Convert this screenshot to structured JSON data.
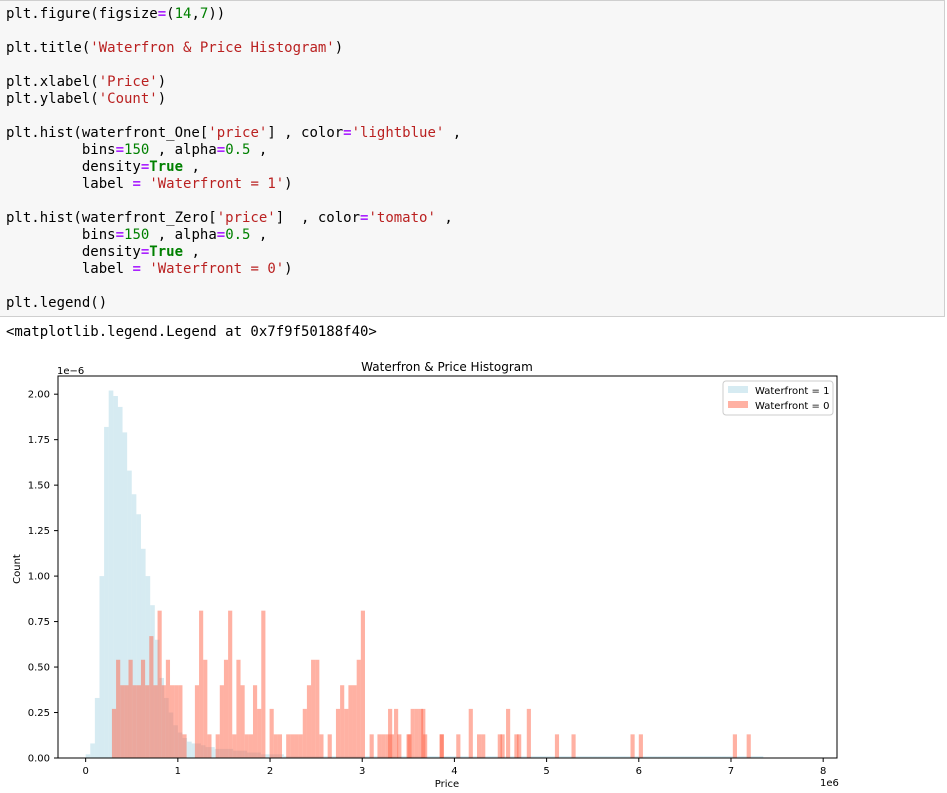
{
  "code_lines": [
    {
      "i": 0,
      "tokens": [
        {
          "t": "plt.figure(figsize",
          "c": ""
        },
        {
          "t": "=",
          "c": "op"
        },
        {
          "t": "(",
          "c": ""
        },
        {
          "t": "14",
          "c": "num"
        },
        {
          "t": ",",
          "c": ""
        },
        {
          "t": "7",
          "c": "num"
        },
        {
          "t": "))",
          "c": ""
        }
      ]
    },
    {
      "i": 2,
      "tokens": [
        {
          "t": "plt.title(",
          "c": ""
        },
        {
          "t": "'Waterfron & Price Histogram'",
          "c": "str"
        },
        {
          "t": ")",
          "c": ""
        }
      ]
    },
    {
      "i": 4,
      "tokens": [
        {
          "t": "plt.xlabel(",
          "c": ""
        },
        {
          "t": "'Price'",
          "c": "str"
        },
        {
          "t": ")",
          "c": ""
        }
      ]
    },
    {
      "i": 5,
      "tokens": [
        {
          "t": "plt.ylabel(",
          "c": ""
        },
        {
          "t": "'Count'",
          "c": "str"
        },
        {
          "t": ")",
          "c": ""
        }
      ]
    },
    {
      "i": 7,
      "tokens": [
        {
          "t": "plt.hist(waterfront_One[",
          "c": ""
        },
        {
          "t": "'price'",
          "c": "str"
        },
        {
          "t": "] , color",
          "c": ""
        },
        {
          "t": "=",
          "c": "op"
        },
        {
          "t": "'lightblue'",
          "c": "str"
        },
        {
          "t": " ,",
          "c": ""
        }
      ]
    },
    {
      "i": 8,
      "tokens": [
        {
          "t": "         bins",
          "c": ""
        },
        {
          "t": "=",
          "c": "op"
        },
        {
          "t": "150",
          "c": "num"
        },
        {
          "t": " , alpha",
          "c": ""
        },
        {
          "t": "=",
          "c": "op"
        },
        {
          "t": "0.5",
          "c": "num"
        },
        {
          "t": " ,",
          "c": ""
        }
      ]
    },
    {
      "i": 9,
      "tokens": [
        {
          "t": "         density",
          "c": ""
        },
        {
          "t": "=",
          "c": "op"
        },
        {
          "t": "True",
          "c": "kw"
        },
        {
          "t": " ,",
          "c": ""
        }
      ]
    },
    {
      "i": 10,
      "tokens": [
        {
          "t": "         label ",
          "c": ""
        },
        {
          "t": "=",
          "c": "op"
        },
        {
          "t": " ",
          "c": ""
        },
        {
          "t": "'Waterfront = 1'",
          "c": "str"
        },
        {
          "t": ")",
          "c": ""
        }
      ]
    },
    {
      "i": 12,
      "tokens": [
        {
          "t": "plt.hist(waterfront_Zero[",
          "c": ""
        },
        {
          "t": "'price'",
          "c": "str"
        },
        {
          "t": "]  , color",
          "c": ""
        },
        {
          "t": "=",
          "c": "op"
        },
        {
          "t": "'tomato'",
          "c": "str"
        },
        {
          "t": " ,",
          "c": ""
        }
      ]
    },
    {
      "i": 13,
      "tokens": [
        {
          "t": "         bins",
          "c": ""
        },
        {
          "t": "=",
          "c": "op"
        },
        {
          "t": "150",
          "c": "num"
        },
        {
          "t": " , alpha",
          "c": ""
        },
        {
          "t": "=",
          "c": "op"
        },
        {
          "t": "0.5",
          "c": "num"
        },
        {
          "t": " ,",
          "c": ""
        }
      ]
    },
    {
      "i": 14,
      "tokens": [
        {
          "t": "         density",
          "c": ""
        },
        {
          "t": "=",
          "c": "op"
        },
        {
          "t": "True",
          "c": "kw"
        },
        {
          "t": " ,",
          "c": ""
        }
      ]
    },
    {
      "i": 15,
      "tokens": [
        {
          "t": "         label ",
          "c": ""
        },
        {
          "t": "=",
          "c": "op"
        },
        {
          "t": " ",
          "c": ""
        },
        {
          "t": "'Waterfront = 0'",
          "c": "str"
        },
        {
          "t": ")",
          "c": ""
        }
      ]
    },
    {
      "i": 17,
      "tokens": [
        {
          "t": "plt.legend()",
          "c": ""
        }
      ]
    }
  ],
  "output_text": "<matplotlib.legend.Legend at 0x7f9f50188f40>",
  "chart_data": {
    "type": "bar",
    "title": "Waterfron & Price Histogram",
    "xlabel": "Price",
    "ylabel": "Count",
    "x_offset_label": "1e6",
    "y_offset_label": "1e−6",
    "xlim": [
      -300000,
      8150000
    ],
    "ylim": [
      0,
      2.1
    ],
    "x_ticks": [
      0,
      1,
      2,
      3,
      4,
      5,
      6,
      7,
      8
    ],
    "x_tick_labels": [
      "0",
      "1",
      "2",
      "3",
      "4",
      "5",
      "6",
      "7",
      "8"
    ],
    "y_ticks": [
      0,
      0.25,
      0.5,
      0.75,
      1.0,
      1.25,
      1.5,
      1.75,
      2.0
    ],
    "y_tick_labels": [
      "0.00",
      "0.25",
      "0.50",
      "0.75",
      "1.00",
      "1.25",
      "1.50",
      "1.75",
      "2.00"
    ],
    "legend_position": "top-right",
    "colors": {
      "series0": "#add8e6",
      "series1": "#ff6347"
    },
    "series": [
      {
        "name": "Waterfront = 1",
        "bin_width": 50000,
        "bin_start": 0,
        "values": [
          0.02,
          0.08,
          0.33,
          1.0,
          1.82,
          2.02,
          1.99,
          1.93,
          1.79,
          1.58,
          1.45,
          1.34,
          1.15,
          1.0,
          0.84,
          0.65,
          0.44,
          0.33,
          0.25,
          0.18,
          0.14,
          0.11,
          0.09,
          0.08,
          0.08,
          0.07,
          0.06,
          0.06,
          0.05,
          0.05,
          0.05,
          0.05,
          0.04,
          0.04,
          0.04,
          0.03,
          0.03,
          0.03,
          0.02,
          0.02,
          0.02,
          0.02,
          0.02,
          0.01,
          0.01,
          0.01,
          0.01,
          0.01,
          0.01,
          0.01,
          0.01,
          0.01,
          0.01,
          0.01,
          0.01,
          0.01,
          0.01,
          0.01,
          0.01,
          0.01,
          0.01,
          0.01,
          0.01,
          0.01,
          0.01,
          0.01,
          0.01,
          0.01,
          0.01,
          0.01,
          0.01,
          0.01,
          0.01,
          0.01,
          0.01,
          0.01,
          0.01,
          0.01,
          0.01,
          0.01,
          0.01,
          0.01,
          0.01,
          0.01,
          0.01,
          0.01,
          0.01,
          0.01,
          0.01,
          0.01,
          0.01,
          0.01,
          0.01,
          0.01,
          0.01,
          0.01,
          0.01,
          0.01,
          0.01,
          0.01,
          0.01,
          0.01,
          0.01,
          0.01,
          0.01,
          0.01,
          0.01,
          0.01,
          0.01,
          0.01,
          0.01,
          0.01,
          0.01,
          0.01,
          0.01,
          0.01,
          0.01,
          0.01,
          0.01,
          0.01,
          0.01,
          0.01,
          0.01,
          0.01,
          0.01,
          0.01,
          0.01,
          0.01,
          0.01,
          0.01,
          0.01,
          0.01,
          0.01,
          0.01,
          0.01,
          0.01,
          0.01,
          0.01,
          0.01,
          0.01,
          0.01,
          0.01,
          0.01,
          0.01,
          0.01,
          0.01,
          0.01
        ]
      },
      {
        "name": "Waterfront = 0",
        "bin_width": 45000,
        "bin_start": 285000,
        "values": [
          0.27,
          0.54,
          0.4,
          0.4,
          0.54,
          0.4,
          0.4,
          0.54,
          0.4,
          0.67,
          0.4,
          0.81,
          0.4,
          0.54,
          0.4,
          0.4,
          0.4,
          0.13,
          0.0,
          0.0,
          0.4,
          0.81,
          0.54,
          0.13,
          0.0,
          0.13,
          0.4,
          0.54,
          0.81,
          0.13,
          0.54,
          0.4,
          0.13,
          0.13,
          0.4,
          0.27,
          0.81,
          0.0,
          0.27,
          0.13,
          0.13,
          0.0,
          0.13,
          0.13,
          0.13,
          0.13,
          0.27,
          0.4,
          0.54,
          0.54,
          0.13,
          0.0,
          0.13,
          0.0,
          0.27,
          0.4,
          0.27,
          0.4,
          0.4,
          0.54,
          0.81,
          0.0,
          0.0,
          0.0,
          0.13,
          0.13,
          0.13,
          0.13,
          0.27,
          0.0,
          0.0,
          0.13,
          0.27,
          0.27,
          0.27,
          0.13,
          0.0,
          0.0,
          0.0,
          0.13,
          0.0,
          0.0,
          0.0,
          0.13,
          0.0,
          0.0,
          0.27,
          0.0,
          0.13,
          0.13,
          0.0,
          0.0,
          0.0,
          0.13,
          0.0,
          0.27,
          0.0,
          0.13,
          0.0,
          0.0,
          0.27,
          0.0,
          0.0,
          0.0,
          0.0,
          0.0,
          0.0,
          0.0,
          0.0,
          0.0,
          0.0,
          0.0,
          0.0,
          0.0,
          0.0,
          0.0,
          0.0,
          0.0,
          0.0,
          0.0,
          0.0,
          0.0,
          0.0,
          0.0,
          0.0,
          0.13,
          0.0,
          0.13,
          0.0,
          0.0,
          0.0,
          0.0,
          0.0,
          0.0,
          0.0,
          0.0,
          0.0,
          0.0,
          0.0,
          0.0,
          0.0,
          0.0,
          0.0,
          0.0,
          0.0,
          0.0,
          0.0,
          0.0,
          0.0,
          0.0,
          0.0,
          0.0,
          0.0,
          0.13
        ]
      }
    ],
    "extra_bars": [
      {
        "series": 1,
        "x": 3080000,
        "value": 0.13
      },
      {
        "series": 1,
        "x": 3280000,
        "value": 0.27
      },
      {
        "series": 1,
        "x": 3380000,
        "value": 0.13
      },
      {
        "series": 1,
        "x": 3490000,
        "value": 0.13
      },
      {
        "series": 1,
        "x": 3640000,
        "value": 0.27
      },
      {
        "series": 1,
        "x": 3840000,
        "value": 0.13
      },
      {
        "series": 1,
        "x": 4500000,
        "value": 0.13
      },
      {
        "series": 1,
        "x": 4680000,
        "value": 0.13
      },
      {
        "series": 1,
        "x": 5090000,
        "value": 0.13
      },
      {
        "series": 1,
        "x": 5270000,
        "value": 0.13
      },
      {
        "series": 1,
        "x": 7020000,
        "value": 0.13
      }
    ]
  }
}
